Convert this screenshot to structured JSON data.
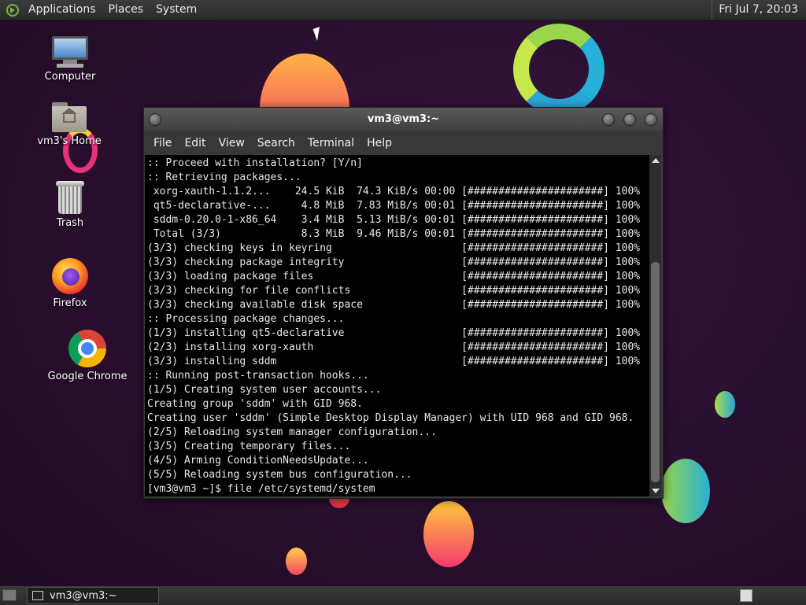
{
  "top_panel": {
    "menus": [
      "Applications",
      "Places",
      "System"
    ],
    "clock": "Fri Jul 7, 20:03"
  },
  "desktop": {
    "icons": [
      {
        "label": "Computer",
        "icon": "computer-icon"
      },
      {
        "label": "vm3's Home",
        "icon": "home-folder-icon"
      },
      {
        "label": "Trash",
        "icon": "trash-icon"
      },
      {
        "label": "Firefox",
        "icon": "firefox-icon"
      },
      {
        "label": "Google Chrome",
        "icon": "chrome-icon"
      }
    ]
  },
  "terminal": {
    "title": "vm3@vm3:~",
    "menu": [
      "File",
      "Edit",
      "View",
      "Search",
      "Terminal",
      "Help"
    ],
    "lines": [
      ":: Proceed with installation? [Y/n]",
      ":: Retrieving packages...",
      " xorg-xauth-1.1.2...    24.5 KiB  74.3 KiB/s 00:00 [######################] 100%",
      " qt5-declarative-...     4.8 MiB  7.83 MiB/s 00:01 [######################] 100%",
      " sddm-0.20.0-1-x86_64    3.4 MiB  5.13 MiB/s 00:01 [######################] 100%",
      " Total (3/3)             8.3 MiB  9.46 MiB/s 00:01 [######################] 100%",
      "(3/3) checking keys in keyring                     [######################] 100%",
      "(3/3) checking package integrity                   [######################] 100%",
      "(3/3) loading package files                        [######################] 100%",
      "(3/3) checking for file conflicts                  [######################] 100%",
      "(3/3) checking available disk space                [######################] 100%",
      ":: Processing package changes...",
      "(1/3) installing qt5-declarative                   [######################] 100%",
      "(2/3) installing xorg-xauth                        [######################] 100%",
      "(3/3) installing sddm                              [######################] 100%",
      ":: Running post-transaction hooks...",
      "(1/5) Creating system user accounts...",
      "Creating group 'sddm' with GID 968.",
      "Creating user 'sddm' (Simple Desktop Display Manager) with UID 968 and GID 968.",
      "(2/5) Reloading system manager configuration...",
      "(3/5) Creating temporary files...",
      "(4/5) Arming ConditionNeedsUpdate...",
      "(5/5) Reloading system bus configuration...",
      "[vm3@vm3 ~]$ file /etc/systemd/system"
    ]
  },
  "taskbar": {
    "tasks": [
      {
        "label": "vm3@vm3:~"
      }
    ]
  }
}
